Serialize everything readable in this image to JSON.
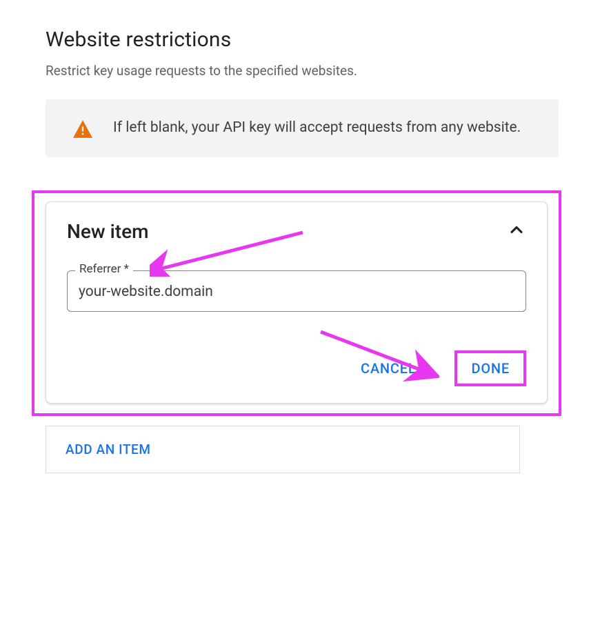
{
  "header": {
    "title": "Website restrictions",
    "subtitle": "Restrict key usage requests to the specified websites."
  },
  "warning": {
    "text": "If left blank, your API key will accept requests from any website."
  },
  "newItem": {
    "title": "New item",
    "field": {
      "label": "Referrer *",
      "value": "your-website.domain"
    },
    "cancelLabel": "CANCEL",
    "doneLabel": "DONE"
  },
  "addItemLabel": "ADD AN ITEM",
  "colors": {
    "highlight": "#e838ef",
    "link": "#1a73e8",
    "warningIcon": "#e8710a"
  }
}
